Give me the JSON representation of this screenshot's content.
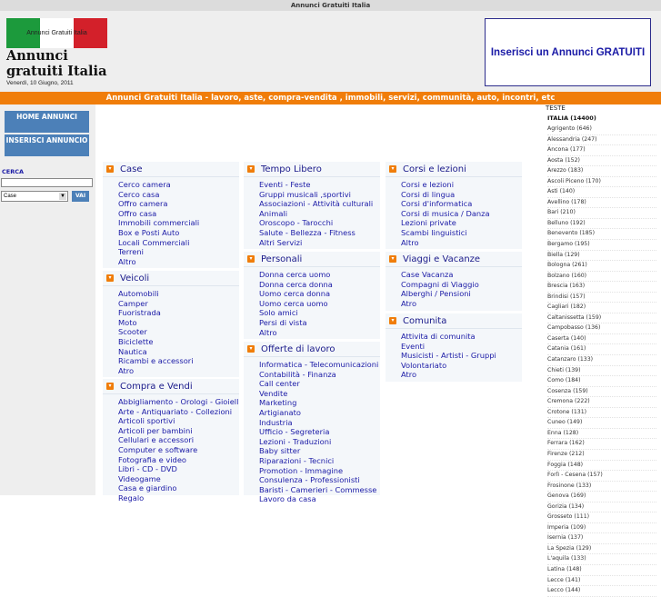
{
  "top_title": "Annunci Gratuiti Italia",
  "header": {
    "flag_text": "Annunci Gratuiti Italia",
    "site_title": "Annunci gratuiti Italia",
    "date": "Venerdì, 10 Giugno, 2011",
    "banner_text": "Inserisci un Annunci GRATUITI",
    "flag_colors": [
      "#1c9a3c",
      "#ffffff",
      "#d3202a"
    ]
  },
  "tagline": "Annunci Gratuiti Italia - lavoro, aste, compra-vendita , immobili, servizi, communità, auto, incontri, etc",
  "sidebar": {
    "home_label": "HOME ANNUNCI",
    "insert_label": "INSERISCI ANNUNCIO",
    "search_label": "CERCA",
    "search_value": "",
    "select_value": "Case",
    "go_label": "VAI"
  },
  "categories": [
    {
      "title": "Case",
      "items": [
        "Cerco camera",
        "Cerco casa",
        "Offro camera",
        "Offro casa",
        "Immobili commerciali",
        "Box e Posti Auto",
        "Locali Commerciali",
        "Terreni",
        "Altro"
      ]
    },
    {
      "title": "Veicoli",
      "items": [
        "Automobili",
        "Camper",
        "Fuoristrada",
        "Moto",
        "Scooter",
        "Biciclette",
        "Nautica",
        "Ricambi e accessori",
        "Atro"
      ]
    },
    {
      "title": "Compra e Vendi",
      "items": [
        "Abbigliamento - Orologi - Gioielli",
        "Arte - Antiquariato - Collezioni",
        "Articoli sportivi",
        "Articoli per bambini",
        "Cellulari e accessori",
        "Computer e software",
        "Fotografia e video",
        "Libri - CD - DVD",
        "Videogame",
        "Casa e giardino",
        "Regalo"
      ]
    },
    {
      "title": "Tempo Libero",
      "items": [
        "Eventi - Feste",
        "Gruppi musicali ,sportivi",
        "Associazioni - Attività culturali",
        "Animali",
        "Oroscopo - Tarocchi",
        "Salute - Bellezza - Fitness",
        "Altri Servizi"
      ]
    },
    {
      "title": "Personali",
      "items": [
        "Donna cerca uomo",
        "Donna cerca donna",
        "Uomo cerca donna",
        "Uomo cerca uomo",
        "Solo amici",
        "Persi di vista",
        "Altro"
      ]
    },
    {
      "title": "Offerte di lavoro",
      "items": [
        "Informatica - Telecomunicazioni",
        "Contabilità - Finanza",
        "Call center",
        "Vendite",
        "Marketing",
        "Artigianato",
        "Industria",
        "Ufficio - Segreteria",
        "Lezioni - Traduzioni",
        "Baby sitter",
        "Riparazioni - Tecnici",
        "Promotion - Immagine",
        "Consulenza - Professionisti",
        "Baristi - Camerieri - Commesse",
        "Lavoro da casa"
      ]
    },
    {
      "title": "Corsi e lezioni",
      "items": [
        "Corsi e lezioni",
        "Corsi di lingua",
        "Corsi d'informatica",
        "Corsi di musica / Danza",
        "Lezioni private",
        "Scambi linguistici",
        "Altro"
      ]
    },
    {
      "title": "Viaggi e Vacanze",
      "items": [
        "Case Vacanza",
        "Compagni di Viaggio",
        "Alberghi / Pensioni",
        "Atro"
      ]
    },
    {
      "title": "Comunita",
      "items": [
        "Attivita di comunita",
        "Eventi",
        "Musicisti - Artisti - Gruppi",
        "Volontariato",
        "Atro"
      ]
    }
  ],
  "right_panel": {
    "heading": "TESTE",
    "top_link": "ITALIA (14400)",
    "cities": [
      "Agrigento (646)",
      "Alessandria (247)",
      "Ancona (177)",
      "Aosta (152)",
      "Arezzo (183)",
      "Ascoli Piceno (170)",
      "Asti (140)",
      "Avellino (178)",
      "Bari (210)",
      "Belluno (192)",
      "Benevento (185)",
      "Bergamo (195)",
      "Biella (129)",
      "Bologna (261)",
      "Bolzano (160)",
      "Brescia (163)",
      "Brindisi (157)",
      "Cagliari (182)",
      "Caltanissetta (159)",
      "Campobasso (136)",
      "Caserta (140)",
      "Catania (161)",
      "Catanzaro (133)",
      "Chieti (139)",
      "Como (184)",
      "Cosenza (159)",
      "Cremona (222)",
      "Crotone (131)",
      "Cuneo (149)",
      "Enna (128)",
      "Ferrara (162)",
      "Firenze (212)",
      "Foggia (148)",
      "Forlì - Cesena (157)",
      "Frosinone (133)",
      "Genova (169)",
      "Gorizia (134)",
      "Grosseto (111)",
      "Imperia (109)",
      "Isernia (137)",
      "La Spezia (129)",
      "L'aquila (133)",
      "Latina (148)",
      "Lecce (141)",
      "Lecco (144)"
    ]
  }
}
